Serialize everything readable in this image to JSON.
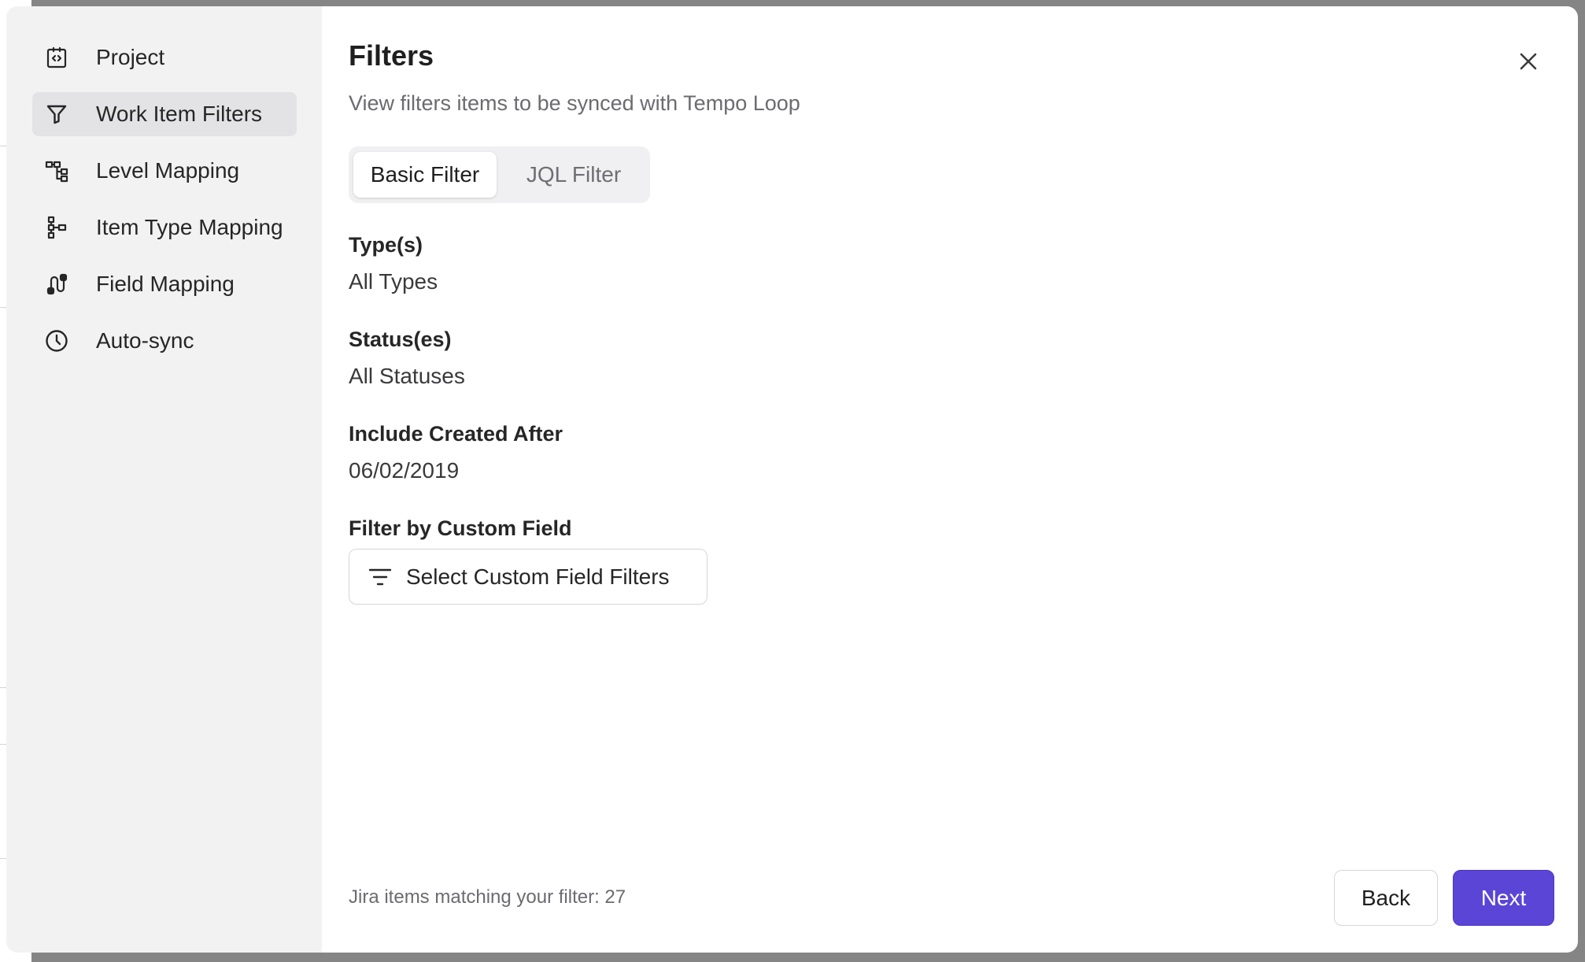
{
  "sidebar": {
    "items": [
      {
        "label": "Project",
        "icon": "project-code-icon"
      },
      {
        "label": "Work Item Filters",
        "icon": "filter-funnel-icon",
        "active": true
      },
      {
        "label": "Level Mapping",
        "icon": "level-mapping-icon"
      },
      {
        "label": "Item Type Mapping",
        "icon": "item-type-mapping-icon"
      },
      {
        "label": "Field Mapping",
        "icon": "field-mapping-icon"
      },
      {
        "label": "Auto-sync",
        "icon": "clock-icon"
      }
    ]
  },
  "header": {
    "title": "Filters",
    "subtitle": "View filters items to be synced with Tempo Loop"
  },
  "tabs": {
    "basic": "Basic Filter",
    "jql": "JQL Filter",
    "active": "basic"
  },
  "fields": {
    "types": {
      "label": "Type(s)",
      "value": "All Types"
    },
    "statuses": {
      "label": "Status(es)",
      "value": "All Statuses"
    },
    "created_after": {
      "label": "Include Created After",
      "value": "06/02/2019"
    },
    "custom_field": {
      "label": "Filter by Custom Field",
      "button": "Select Custom Field Filters"
    }
  },
  "footer": {
    "match_text": "Jira items matching your filter: 27",
    "back_label": "Back",
    "next_label": "Next"
  },
  "colors": {
    "accent": "#5b45d6",
    "sidebar_bg": "#f2f2f3",
    "active_nav_bg": "#e3e3e5"
  }
}
